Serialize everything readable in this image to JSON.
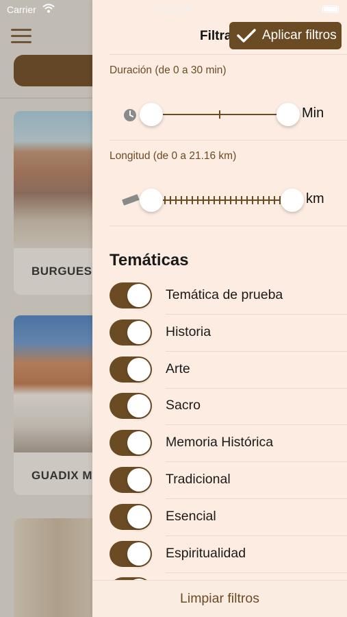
{
  "status_bar": {
    "carrier": "Carrier",
    "time": "6:33 AM"
  },
  "background": {
    "cards": [
      {
        "title": "BURGUES"
      },
      {
        "title": "GUADIX M"
      },
      {
        "title": ""
      }
    ]
  },
  "drawer": {
    "title": "Filtra",
    "apply_label": "Aplicar filtros",
    "duration": {
      "label": "Duración (de 0 a 30 min)",
      "unit": "Min",
      "min": 0,
      "max": 30,
      "selected_min": 0,
      "selected_max": 30
    },
    "distance": {
      "label": "Longitud (de 0 a 21.16 km)",
      "unit": "km",
      "min": 0,
      "max": 21.16,
      "selected_min": 0,
      "selected_max": 21.16
    },
    "themes_heading": "Temáticas",
    "themes": [
      {
        "label": "Temática de prueba",
        "on": true
      },
      {
        "label": "Historia",
        "on": true
      },
      {
        "label": "Arte",
        "on": true
      },
      {
        "label": "Sacro",
        "on": true
      },
      {
        "label": "Memoria Histórica",
        "on": true
      },
      {
        "label": "Tradicional",
        "on": true
      },
      {
        "label": "Esencial",
        "on": true
      },
      {
        "label": "Espiritualidad",
        "on": true
      }
    ],
    "clear_label": "Limpiar filtros"
  },
  "colors": {
    "accent": "#6b4b23",
    "drawer_bg": "#fcece1"
  }
}
